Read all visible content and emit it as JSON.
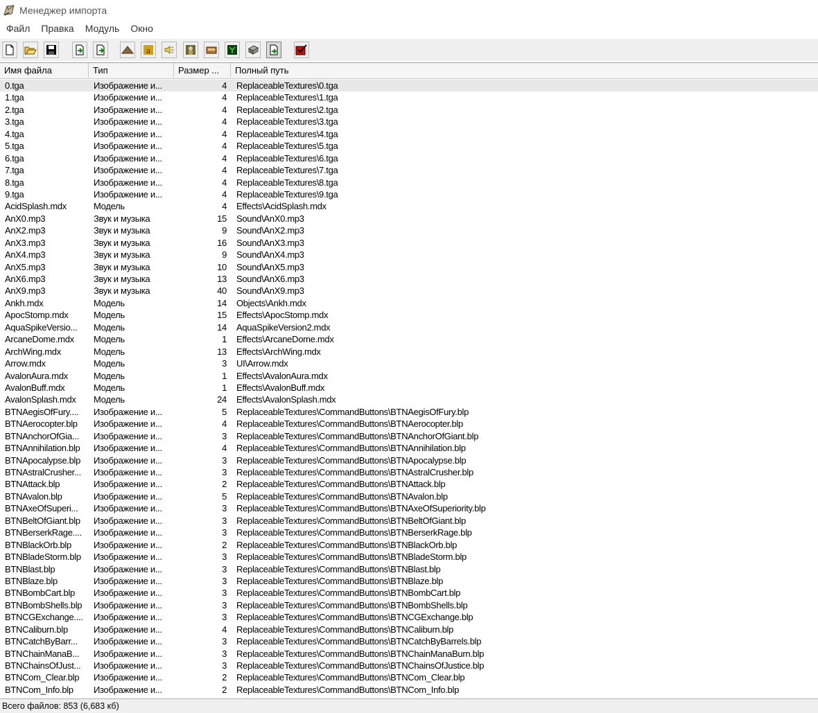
{
  "window": {
    "title": "Менеджер импорта"
  },
  "menu": [
    "Файл",
    "Правка",
    "Модуль",
    "Окно"
  ],
  "toolbar": [
    {
      "icon": "new-file-icon"
    },
    {
      "icon": "open-folder-icon"
    },
    {
      "icon": "save-icon"
    },
    {
      "icon": "import-file-icon"
    },
    {
      "icon": "export-file-icon"
    },
    {
      "icon": "terrain-icon"
    },
    {
      "icon": "ability-icon"
    },
    {
      "icon": "sound-icon"
    },
    {
      "icon": "unit-icon"
    },
    {
      "icon": "item-icon"
    },
    {
      "icon": "ai-editor-icon"
    },
    {
      "icon": "object-icon"
    },
    {
      "icon": "import-manager-icon"
    },
    {
      "icon": "test-map-icon"
    }
  ],
  "columns": [
    "Имя файла",
    "Тип",
    "Размер ...",
    "Полный путь"
  ],
  "rows": [
    [
      "0.tga",
      "Изображение и...",
      "4",
      "ReplaceableTextures\\0.tga"
    ],
    [
      "1.tga",
      "Изображение и...",
      "4",
      "ReplaceableTextures\\1.tga"
    ],
    [
      "2.tga",
      "Изображение и...",
      "4",
      "ReplaceableTextures\\2.tga"
    ],
    [
      "3.tga",
      "Изображение и...",
      "4",
      "ReplaceableTextures\\3.tga"
    ],
    [
      "4.tga",
      "Изображение и...",
      "4",
      "ReplaceableTextures\\4.tga"
    ],
    [
      "5.tga",
      "Изображение и...",
      "4",
      "ReplaceableTextures\\5.tga"
    ],
    [
      "6.tga",
      "Изображение и...",
      "4",
      "ReplaceableTextures\\6.tga"
    ],
    [
      "7.tga",
      "Изображение и...",
      "4",
      "ReplaceableTextures\\7.tga"
    ],
    [
      "8.tga",
      "Изображение и...",
      "4",
      "ReplaceableTextures\\8.tga"
    ],
    [
      "9.tga",
      "Изображение и...",
      "4",
      "ReplaceableTextures\\9.tga"
    ],
    [
      "AcidSplash.mdx",
      "Модель",
      "4",
      "Effects\\AcidSplash.mdx"
    ],
    [
      "AnX0.mp3",
      "Звук и музыка",
      "15",
      "Sound\\AnX0.mp3"
    ],
    [
      "AnX2.mp3",
      "Звук и музыка",
      "9",
      "Sound\\AnX2.mp3"
    ],
    [
      "AnX3.mp3",
      "Звук и музыка",
      "16",
      "Sound\\AnX3.mp3"
    ],
    [
      "AnX4.mp3",
      "Звук и музыка",
      "9",
      "Sound\\AnX4.mp3"
    ],
    [
      "AnX5.mp3",
      "Звук и музыка",
      "10",
      "Sound\\AnX5.mp3"
    ],
    [
      "AnX6.mp3",
      "Звук и музыка",
      "13",
      "Sound\\AnX6.mp3"
    ],
    [
      "AnX9.mp3",
      "Звук и музыка",
      "40",
      "Sound\\AnX9.mp3"
    ],
    [
      "Ankh.mdx",
      "Модель",
      "14",
      "Objects\\Ankh.mdx"
    ],
    [
      "ApocStomp.mdx",
      "Модель",
      "15",
      "Effects\\ApocStomp.mdx"
    ],
    [
      "AquaSpikeVersio...",
      "Модель",
      "14",
      "AquaSpikeVersion2.mdx"
    ],
    [
      "ArcaneDome.mdx",
      "Модель",
      "1",
      "Effects\\ArcaneDome.mdx"
    ],
    [
      "ArchWing.mdx",
      "Модель",
      "13",
      "Effects\\ArchWing.mdx"
    ],
    [
      "Arrow.mdx",
      "Модель",
      "3",
      "UI\\Arrow.mdx"
    ],
    [
      "AvalonAura.mdx",
      "Модель",
      "1",
      "Effects\\AvalonAura.mdx"
    ],
    [
      "AvalonBuff.mdx",
      "Модель",
      "1",
      "Effects\\AvalonBuff.mdx"
    ],
    [
      "AvalonSplash.mdx",
      "Модель",
      "24",
      "Effects\\AvalonSplash.mdx"
    ],
    [
      "BTNAegisOfFury....",
      "Изображение и...",
      "5",
      "ReplaceableTextures\\CommandButtons\\BTNAegisOfFury.blp"
    ],
    [
      "BTNAerocopter.blp",
      "Изображение и...",
      "4",
      "ReplaceableTextures\\CommandButtons\\BTNAerocopter.blp"
    ],
    [
      "BTNAnchorOfGia...",
      "Изображение и...",
      "3",
      "ReplaceableTextures\\CommandButtons\\BTNAnchorOfGiant.blp"
    ],
    [
      "BTNAnnihilation.blp",
      "Изображение и...",
      "4",
      "ReplaceableTextures\\CommandButtons\\BTNAnnihilation.blp"
    ],
    [
      "BTNApocalypse.blp",
      "Изображение и...",
      "3",
      "ReplaceableTextures\\CommandButtons\\BTNApocalypse.blp"
    ],
    [
      "BTNAstralCrusher...",
      "Изображение и...",
      "3",
      "ReplaceableTextures\\CommandButtons\\BTNAstralCrusher.blp"
    ],
    [
      "BTNAttack.blp",
      "Изображение и...",
      "2",
      "ReplaceableTextures\\CommandButtons\\BTNAttack.blp"
    ],
    [
      "BTNAvalon.blp",
      "Изображение и...",
      "5",
      "ReplaceableTextures\\CommandButtons\\BTNAvalon.blp"
    ],
    [
      "BTNAxeOfSuperi...",
      "Изображение и...",
      "3",
      "ReplaceableTextures\\CommandButtons\\BTNAxeOfSuperiority.blp"
    ],
    [
      "BTNBeltOfGiant.blp",
      "Изображение и...",
      "3",
      "ReplaceableTextures\\CommandButtons\\BTNBeltOfGiant.blp"
    ],
    [
      "BTNBerserkRage....",
      "Изображение и...",
      "3",
      "ReplaceableTextures\\CommandButtons\\BTNBerserkRage.blp"
    ],
    [
      "BTNBlackOrb.blp",
      "Изображение и...",
      "2",
      "ReplaceableTextures\\CommandButtons\\BTNBlackOrb.blp"
    ],
    [
      "BTNBladeStorm.blp",
      "Изображение и...",
      "3",
      "ReplaceableTextures\\CommandButtons\\BTNBladeStorm.blp"
    ],
    [
      "BTNBlast.blp",
      "Изображение и...",
      "3",
      "ReplaceableTextures\\CommandButtons\\BTNBlast.blp"
    ],
    [
      "BTNBlaze.blp",
      "Изображение и...",
      "3",
      "ReplaceableTextures\\CommandButtons\\BTNBlaze.blp"
    ],
    [
      "BTNBombCart.blp",
      "Изображение и...",
      "3",
      "ReplaceableTextures\\CommandButtons\\BTNBombCart.blp"
    ],
    [
      "BTNBombShells.blp",
      "Изображение и...",
      "3",
      "ReplaceableTextures\\CommandButtons\\BTNBombShells.blp"
    ],
    [
      "BTNCGExchange....",
      "Изображение и...",
      "3",
      "ReplaceableTextures\\CommandButtons\\BTNCGExchange.blp"
    ],
    [
      "BTNCaliburn.blp",
      "Изображение и...",
      "4",
      "ReplaceableTextures\\CommandButtons\\BTNCaliburn.blp"
    ],
    [
      "BTNCatchByBarr...",
      "Изображение и...",
      "3",
      "ReplaceableTextures\\CommandButtons\\BTNCatchByBarrels.blp"
    ],
    [
      "BTNChainManaB...",
      "Изображение и...",
      "3",
      "ReplaceableTextures\\CommandButtons\\BTNChainManaBurn.blp"
    ],
    [
      "BTNChainsOfJust...",
      "Изображение и...",
      "3",
      "ReplaceableTextures\\CommandButtons\\BTNChainsOfJustice.blp"
    ],
    [
      "BTNCom_Clear.blp",
      "Изображение и...",
      "2",
      "ReplaceableTextures\\CommandButtons\\BTNCom_Clear.blp"
    ],
    [
      "BTNCom_Info.blp",
      "Изображение и...",
      "2",
      "ReplaceableTextures\\CommandButtons\\BTNCom_Info.blp"
    ]
  ],
  "status": "Всего файлов: 853 (6,683 кб)"
}
